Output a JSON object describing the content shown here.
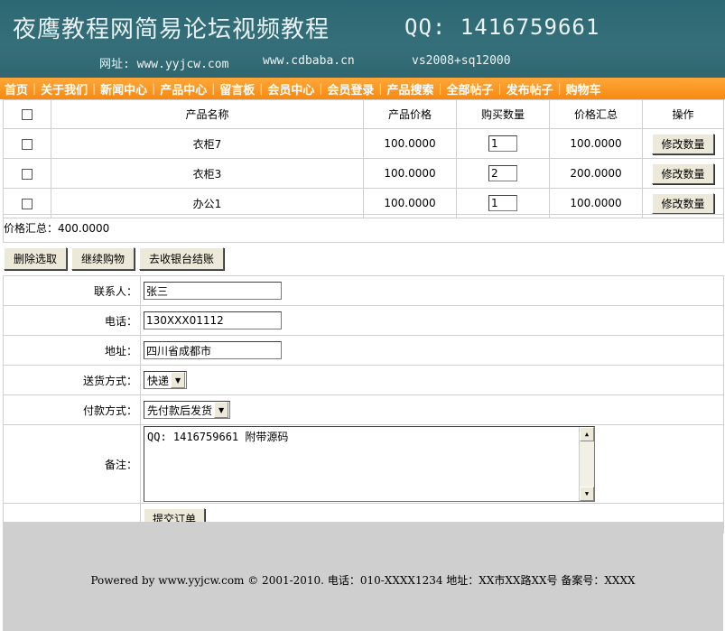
{
  "banner": {
    "title": "夜鹰教程网简易论坛视频教程",
    "qq": "QQ: 1416759661",
    "site_label": "网址: www.yyjcw.com",
    "site2": "www.cdbaba.cn",
    "tech": "vs2008+sq12000"
  },
  "nav": [
    "首页",
    "关于我们",
    "新闻中心",
    "产品中心",
    "留言板",
    "会员中心",
    "会员登录",
    "产品搜索",
    "全部帖子",
    "发布帖子",
    "购物车"
  ],
  "cart": {
    "headers": [
      "产品名称",
      "产品价格",
      "购买数量",
      "价格汇总",
      "操作"
    ],
    "rows": [
      {
        "name": "衣柜7",
        "price": "100.0000",
        "qty": "1",
        "subtotal": "100.0000",
        "action": "修改数量"
      },
      {
        "name": "衣柜3",
        "price": "100.0000",
        "qty": "2",
        "subtotal": "200.0000",
        "action": "修改数量"
      },
      {
        "name": "办公1",
        "price": "100.0000",
        "qty": "1",
        "subtotal": "100.0000",
        "action": "修改数量"
      }
    ]
  },
  "total": "价格汇总：400.0000",
  "actions": {
    "delete": "删除选取",
    "continue": "继续购物",
    "checkout": "去收银台结账"
  },
  "form": {
    "contact_label": "联系人：",
    "contact_value": "张三",
    "phone_label": "电话：",
    "phone_value": "130XXX01112",
    "address_label": "地址：",
    "address_value": "四川省成都市",
    "delivery_label": "送货方式：",
    "delivery_value": "快递",
    "payment_label": "付款方式：",
    "payment_value": "先付款后发货",
    "note_label": "备注：",
    "note_value": "QQ: 1416759661 附带源码",
    "submit": "提交订单"
  },
  "footer": "Powered by www.yyjcw.com © 2001-2010. 电话：010-XXXX1234 地址：XX市XX路XX号 备案号：XXXX"
}
